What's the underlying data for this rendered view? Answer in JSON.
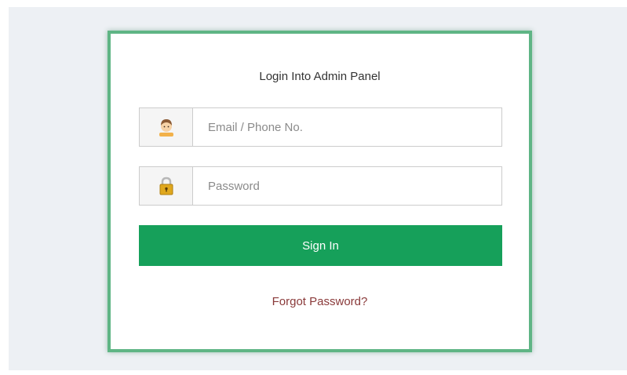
{
  "login": {
    "title": "Login Into Admin Panel",
    "email": {
      "placeholder": "Email / Phone No.",
      "value": "",
      "icon": "user-avatar-icon"
    },
    "password": {
      "placeholder": "Password",
      "value": "",
      "icon": "padlock-icon"
    },
    "submit_label": "Sign In",
    "forgot_label": "Forgot Password?"
  },
  "colors": {
    "page_background": "#edf0f4",
    "card_border": "#5fb585",
    "button": "#16a05a",
    "link": "#8a3a3a"
  }
}
